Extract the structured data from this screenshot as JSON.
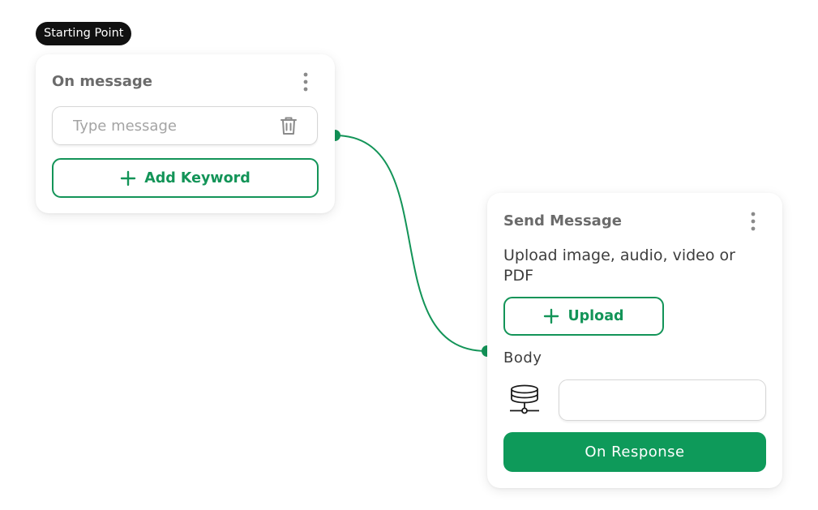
{
  "badge": {
    "label": "Starting Point"
  },
  "on_message_node": {
    "title": "On message",
    "keyword_input": {
      "placeholder": "Type message",
      "value": ""
    },
    "add_keyword_label": "Add Keyword"
  },
  "send_message_node": {
    "title": "Send Message",
    "upload_hint": "Upload image, audio, video or PDF",
    "upload_label": "Upload",
    "body_label": "Body",
    "body_input": {
      "value": ""
    },
    "on_response_label": "On Response"
  },
  "icons": {
    "menu": "kebab-vertical-icon",
    "delete": "trash-icon",
    "add": "plus-icon",
    "variable": "database-icon"
  },
  "colors": {
    "accent": "#0e9a5a",
    "connector": "#139458",
    "badge_bg": "#111111",
    "title": "#6b6b6b"
  }
}
